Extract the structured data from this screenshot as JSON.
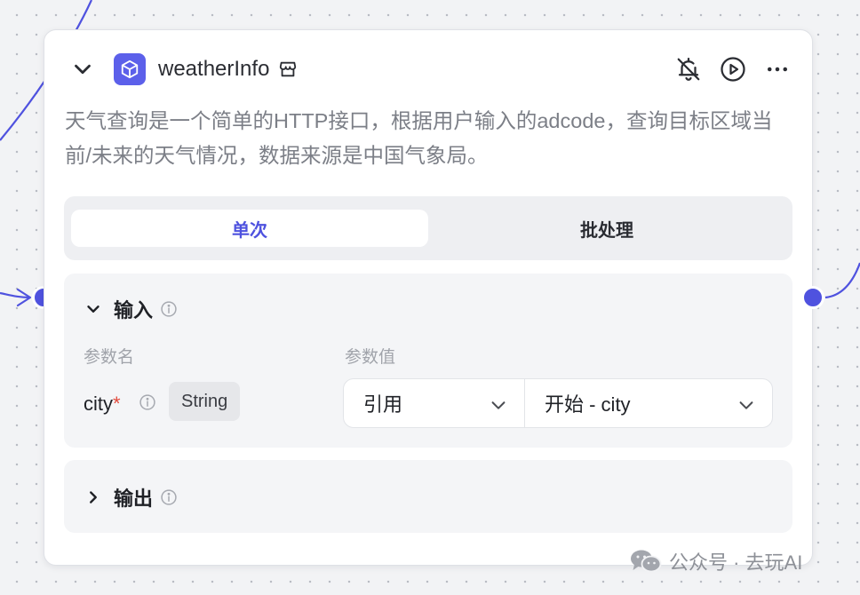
{
  "node": {
    "title": "weatherInfo",
    "description": "天气查询是一个简单的HTTP接口，根据用户输入的adcode，查询目标区域当前/未来的天气情况，数据来源是中国气象局。",
    "icons": {
      "collapse": "chevron-down-icon",
      "logo": "cube-icon",
      "store": "plugin-store-icon",
      "debug_off": "bell-off-icon",
      "run": "play-circle-icon",
      "more": "more-horizontal-icon"
    }
  },
  "tabs": [
    {
      "label": "单次",
      "active": true
    },
    {
      "label": "批处理",
      "active": false
    }
  ],
  "input_section": {
    "title": "输入",
    "column_headers": {
      "name": "参数名",
      "value": "参数值"
    },
    "params": [
      {
        "name": "city",
        "required_mark": "*",
        "type": "String",
        "source": "引用",
        "value": "开始 - city"
      }
    ]
  },
  "output_section": {
    "title": "输出"
  },
  "watermark": {
    "text": "公众号 · 去玩AI"
  },
  "colors": {
    "accent": "#4f52df",
    "required": "#e24a3c",
    "canvas": "#f2f3f5"
  }
}
